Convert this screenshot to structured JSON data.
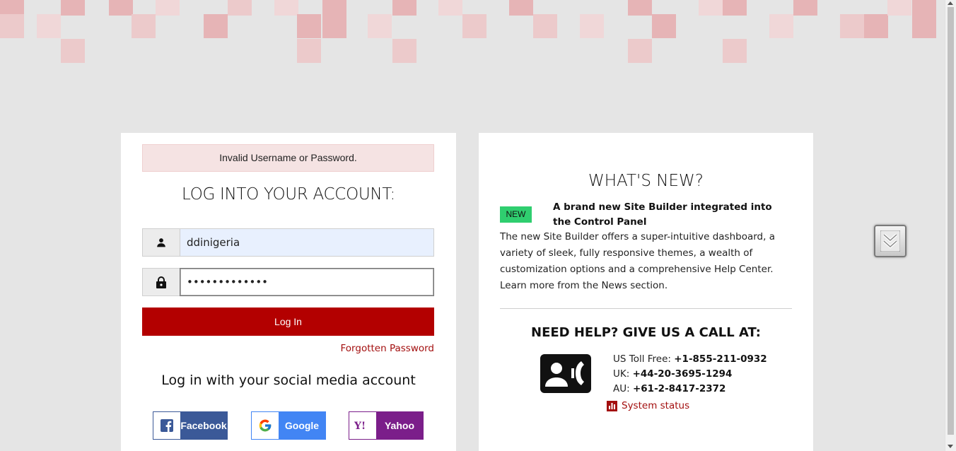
{
  "login": {
    "error_message": "Invalid Username or Password.",
    "title": "LOG INTO YOUR ACCOUNT:",
    "username_value": "ddinigeria",
    "password_value": "•••••••••••••",
    "login_button": "Log In",
    "forgot_link": "Forgotten Password",
    "social_title": "Log in with your social media account",
    "social": {
      "facebook": "Facebook",
      "google": "Google",
      "yahoo": "Yahoo"
    },
    "icons": [
      "user-icon",
      "lock-icon",
      "facebook-icon",
      "google-icon",
      "yahoo-icon"
    ]
  },
  "news": {
    "title": "WHAT'S NEW?",
    "badge": "NEW",
    "headline": "A brand new Site Builder integrated into the Control Panel",
    "body": "The new Site Builder offers a super-intuitive dashboard, a variety of sleek, fully responsive themes, a wealth of customization options and a comprehensive Help Center. Learn more from the News section."
  },
  "help": {
    "title": "NEED HELP? GIVE US A CALL AT:",
    "us_label": "US Toll Free: ",
    "us_number": "+1-855-211-0932",
    "uk_label": "UK: ",
    "uk_number": "+44-20-3695-1294",
    "au_label": "AU: ",
    "au_number": "+61-2-8417-2372",
    "status_link": "System status",
    "icons": [
      "contact-phone-icon",
      "bar-chart-icon"
    ]
  },
  "colors": {
    "brand_red": "#b30000",
    "link_red": "#a30f0f",
    "badge_green": "#2fce6f",
    "facebook": "#3b5998",
    "google": "#4285f4",
    "yahoo": "#7b1e8a",
    "background": "#e5e5e5"
  }
}
